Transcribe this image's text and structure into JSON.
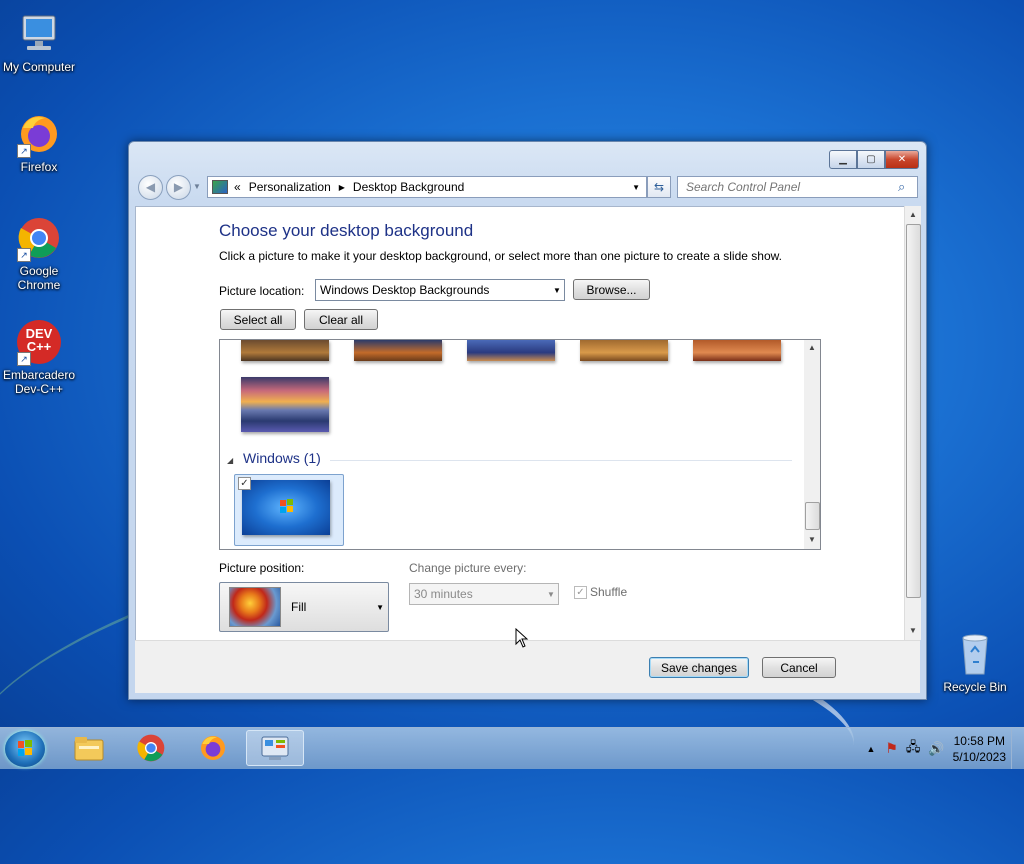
{
  "desktop": {
    "icons": [
      {
        "label": "My Computer"
      },
      {
        "label": "Firefox"
      },
      {
        "label": "Google Chrome"
      },
      {
        "label": "Embarcadero Dev-C++"
      },
      {
        "label": "Recycle Bin"
      }
    ],
    "devcpp_icon_text": "DEV C++"
  },
  "window": {
    "address": {
      "root_chevron": "«",
      "crumbs": [
        "Personalization",
        "Desktop Background"
      ]
    },
    "search_placeholder": "Search Control Panel",
    "heading": "Choose your desktop background",
    "description": "Click a picture to make it your desktop background, or select more than one picture to create a slide show.",
    "picture_location_label": "Picture location:",
    "picture_location_value": "Windows Desktop Backgrounds",
    "browse_label": "Browse...",
    "select_all_label": "Select all",
    "clear_all_label": "Clear all",
    "group_name": "Windows (1)",
    "picture_position_label": "Picture position:",
    "picture_position_value": "Fill",
    "change_every_label": "Change picture every:",
    "change_every_value": "30 minutes",
    "shuffle_label": "Shuffle",
    "save_label": "Save changes",
    "cancel_label": "Cancel"
  },
  "taskbar": {
    "time": "10:58 PM",
    "date": "5/10/2023"
  }
}
